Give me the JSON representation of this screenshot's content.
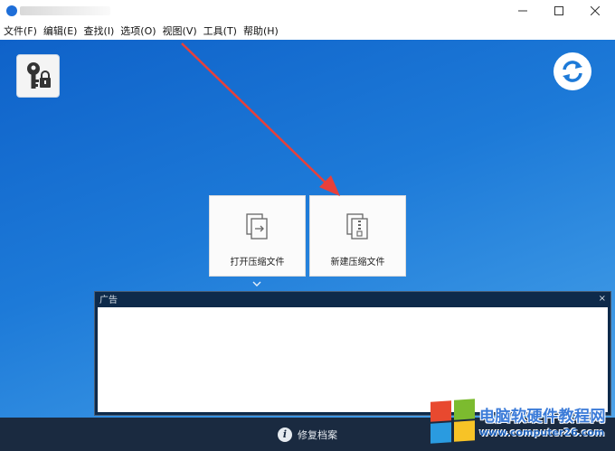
{
  "menu": [
    "文件(F)",
    "编辑(E)",
    "查找(I)",
    "选项(O)",
    "视图(V)",
    "工具(T)",
    "帮助(H)"
  ],
  "cards": {
    "open_label": "打开压缩文件",
    "new_label": "新建压缩文件"
  },
  "ad": {
    "title": "广告",
    "close": "×"
  },
  "status": {
    "repair_label": "修复档案"
  },
  "watermark": {
    "title": "电脑软硬件教程网",
    "url": "www.computer26.com"
  },
  "icons": {
    "key_lock": "key-lock-icon",
    "refresh": "refresh-icon",
    "open_archive": "open-archive-icon",
    "new_archive": "new-archive-icon",
    "info": "info-icon",
    "chevron": "chevron-down-icon"
  },
  "colors": {
    "accent_blue": "#1d7ad8",
    "ad_frame": "#0e2a4a",
    "status_bar": "#1a2a40",
    "arrow_red": "#e8403a"
  }
}
